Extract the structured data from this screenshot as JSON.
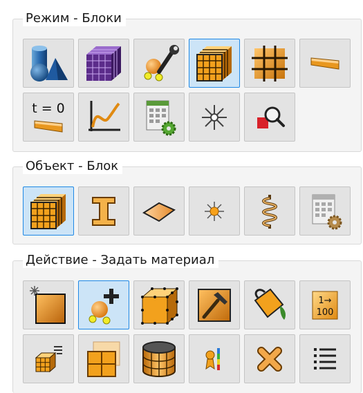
{
  "groups": [
    {
      "title": "Режим - Блоки",
      "buttons": [
        {
          "icon": "geometry-shapes-icon",
          "active": false
        },
        {
          "icon": "mesh-block-icon",
          "active": false
        },
        {
          "icon": "mesh-tools-icon",
          "active": false
        },
        {
          "icon": "blocks-icon",
          "active": true
        },
        {
          "icon": "block-grid-icon",
          "active": false
        },
        {
          "icon": "beam-icon",
          "active": false
        },
        {
          "icon": "initial-conditions-icon",
          "active": false,
          "label": "t = 0"
        },
        {
          "icon": "graph-icon",
          "active": false
        },
        {
          "icon": "calculator-settings-icon",
          "active": false
        },
        {
          "icon": "load-star-icon",
          "active": false
        },
        {
          "icon": "inspect-icon",
          "active": false
        }
      ]
    },
    {
      "title": "Объект - Блок",
      "buttons": [
        {
          "icon": "block-object-icon",
          "active": true
        },
        {
          "icon": "i-beam-icon",
          "active": false
        },
        {
          "icon": "surface-icon",
          "active": false
        },
        {
          "icon": "point-icon",
          "active": false
        },
        {
          "icon": "spring-icon",
          "active": false
        },
        {
          "icon": "object-settings-icon",
          "active": false
        }
      ]
    },
    {
      "title": "Действие - Задать материал",
      "buttons": [
        {
          "icon": "new-block-icon",
          "active": false
        },
        {
          "icon": "add-material-icon",
          "active": true
        },
        {
          "icon": "block-nodes-icon",
          "active": false
        },
        {
          "icon": "hammer-icon",
          "active": false
        },
        {
          "icon": "fill-bucket-icon",
          "active": false
        },
        {
          "icon": "numbering-icon",
          "active": false,
          "label_top": "1→",
          "label_bottom": "100"
        },
        {
          "icon": "block-list-icon",
          "active": false
        },
        {
          "icon": "split-block-icon",
          "active": false
        },
        {
          "icon": "cylinder-icon",
          "active": false
        },
        {
          "icon": "material-palette-icon",
          "active": false
        },
        {
          "icon": "delete-icon",
          "active": false
        },
        {
          "icon": "list-icon",
          "active": false
        }
      ]
    }
  ]
}
